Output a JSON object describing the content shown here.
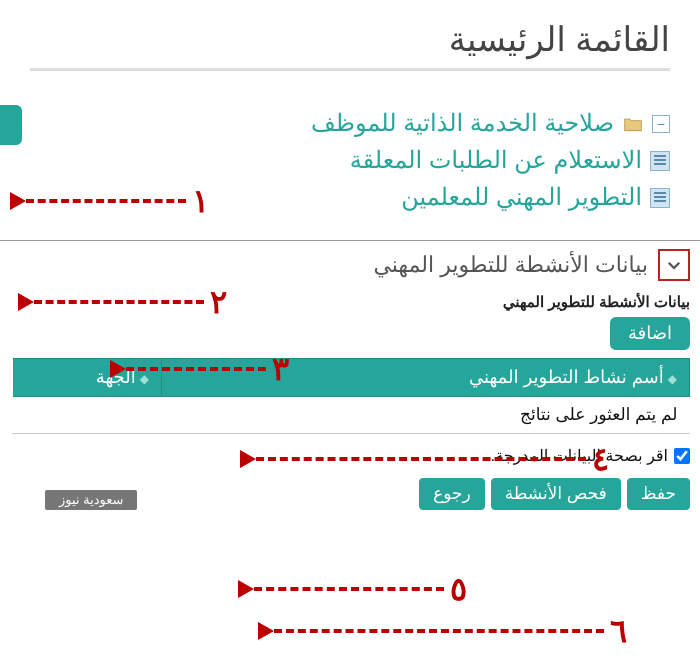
{
  "header": {
    "title": "القائمة الرئيسية"
  },
  "nav": {
    "items": [
      {
        "label": "صلاحية الخدمة الذاتية للموظف",
        "icon": "folder"
      },
      {
        "label": "الاستعلام عن الطلبات المعلقة",
        "icon": "doc"
      },
      {
        "label": "التطوير المهني للمعلمين",
        "icon": "doc"
      }
    ]
  },
  "section": {
    "title": "بيانات الأنشطة للتطوير المهني",
    "sublabel": "بيانات الأنشطة للتطوير المهني"
  },
  "buttons": {
    "add": "اضافة",
    "save": "حفظ",
    "check": "فحص الأنشطة",
    "back": "رجوع"
  },
  "table": {
    "col_activity": "أسم نشاط التطوير المهني",
    "col_entity": "الجهة",
    "no_results": "لم يتم العثور على نتائج"
  },
  "confirm": {
    "label": "اقر بصحة البيانات المدرجة."
  },
  "annotations": {
    "n1": "١",
    "n2": "٢",
    "n3": "٣",
    "n4": "٤",
    "n5": "٥",
    "n6": "٦"
  },
  "watermark": "سعودية نيوز"
}
